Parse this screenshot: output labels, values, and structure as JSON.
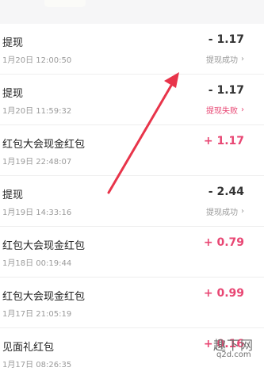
{
  "transactions": [
    {
      "title": "提现",
      "time": "1月20日 12:00:50",
      "amount": "- 1.17",
      "status": "提现成功"
    },
    {
      "title": "提现",
      "time": "1月20日 11:59:32",
      "amount": "- 1.17",
      "status": "提现失败"
    },
    {
      "title": "红包大会现金红包",
      "time": "1月19日 22:48:07",
      "amount": "+ 1.17",
      "status": ""
    },
    {
      "title": "提现",
      "time": "1月19日 14:33:16",
      "amount": "- 2.44",
      "status": "提现成功"
    },
    {
      "title": "红包大会现金红包",
      "time": "1月18日 00:19:44",
      "amount": "+ 0.79",
      "status": ""
    },
    {
      "title": "红包大会现金红包",
      "time": "1月17日 21:05:19",
      "amount": "+ 0.99",
      "status": ""
    },
    {
      "title": "见面礼红包",
      "time": "1月17日 08:26:35",
      "amount": "+ 0.16",
      "status": ""
    }
  ],
  "chevron": "›",
  "colors": {
    "positive_amount": "#e84673",
    "negative_amount": "#333333",
    "status_fail": "#e84673",
    "status_ok": "#9a9a9a",
    "annotation_arrow": "#e8344a"
  },
  "watermark": {
    "text": "趣下网",
    "url": "q2d.com"
  }
}
